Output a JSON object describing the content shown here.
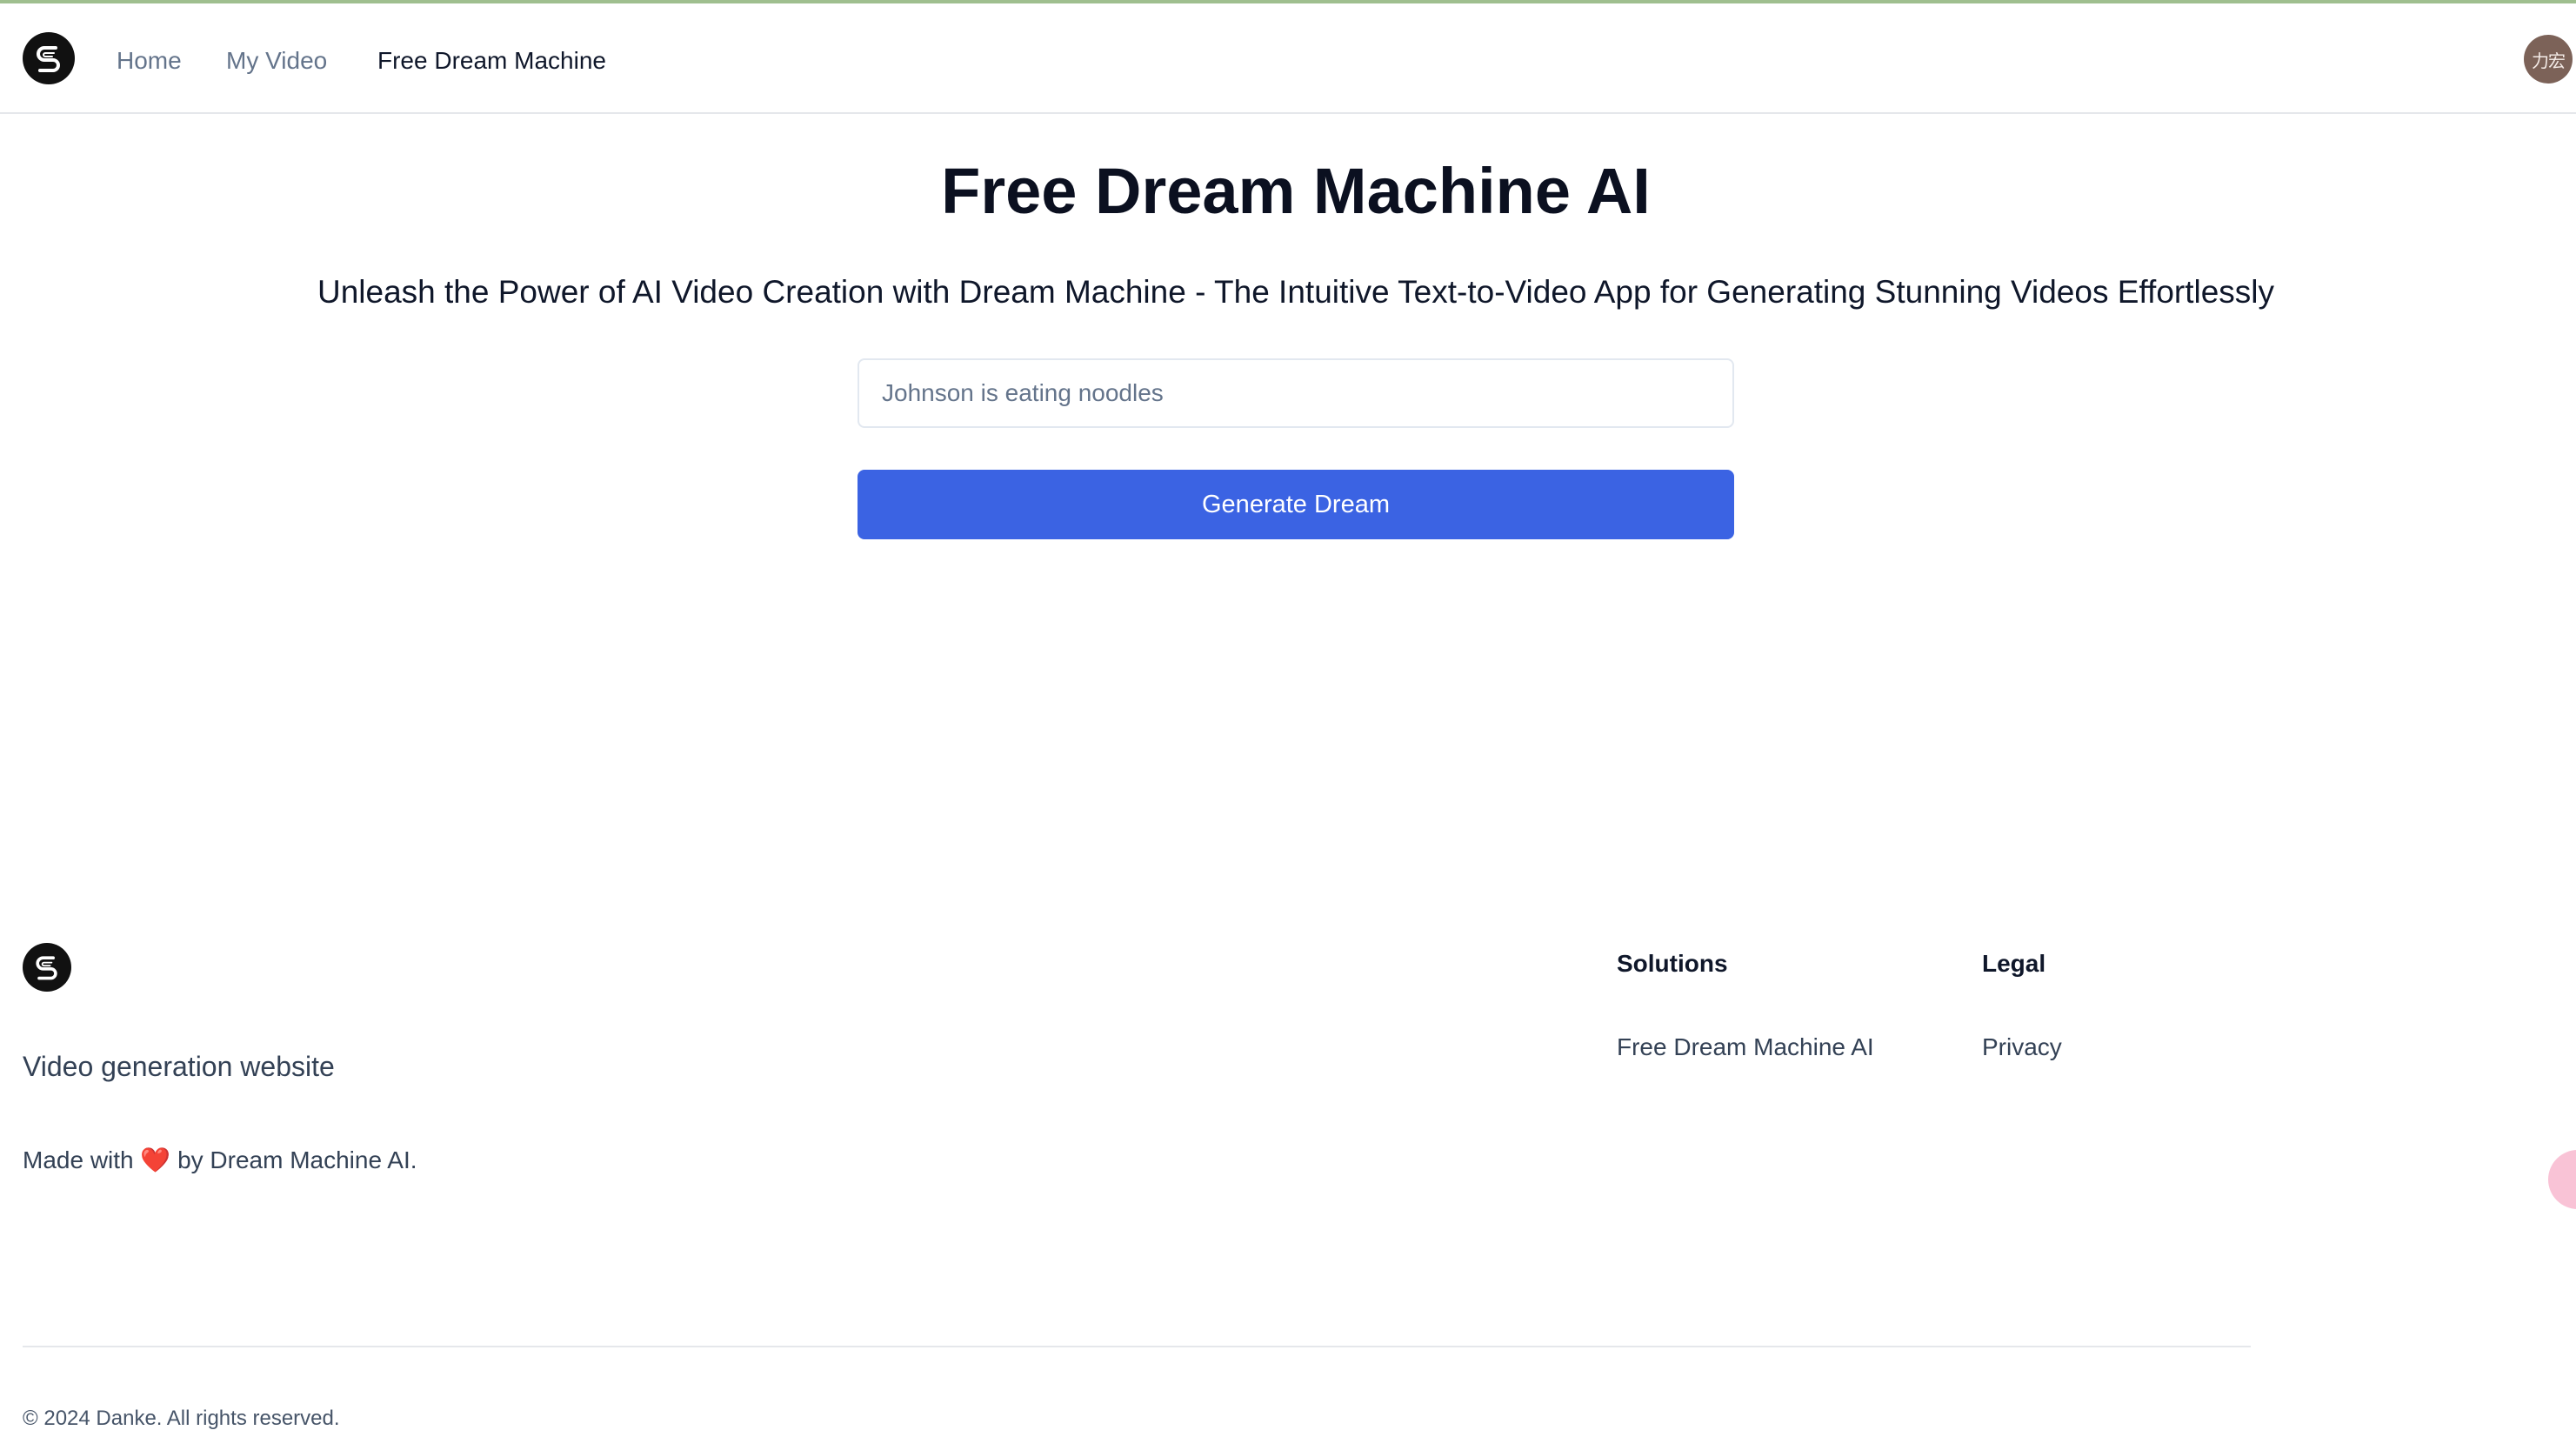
{
  "header": {
    "nav": [
      {
        "label": "Home"
      },
      {
        "label": "My Video"
      },
      {
        "label": "Free Dream Machine"
      }
    ],
    "avatar_text": "力宏"
  },
  "main": {
    "title": "Free Dream Machine AI",
    "subtitle": "Unleash the Power of AI Video Creation with Dream Machine - The Intuitive Text-to-Video App for Generating Stunning Videos Effortlessly",
    "prompt_placeholder": "Johnson is eating noodles",
    "prompt_value": "",
    "generate_label": "Generate Dream"
  },
  "footer": {
    "tagline": "Video generation website",
    "made_with_prefix": "Made with",
    "made_with_heart": "❤️",
    "made_with_suffix": "by Dream Machine AI.",
    "columns": [
      {
        "title": "Solutions",
        "links": [
          {
            "label": "Free Dream Machine AI"
          }
        ]
      },
      {
        "title": "Legal",
        "links": [
          {
            "label": "Privacy"
          }
        ]
      }
    ],
    "copyright": "© 2024 Danke. All rights reserved."
  },
  "colors": {
    "accent": "#3b63e3",
    "heading": "#0b1020",
    "muted": "#64748b",
    "avatar_bg": "#7c6258",
    "widget_bg": "#f9c3d6"
  },
  "icons": {
    "logo": "s-logo-icon",
    "heart": "heart-icon"
  }
}
